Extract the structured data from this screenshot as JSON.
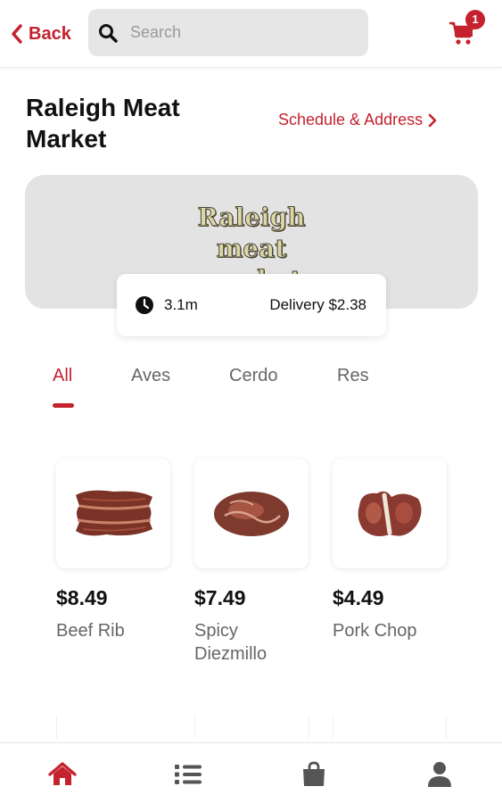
{
  "header": {
    "back_label": "Back",
    "search_placeholder": "Search",
    "cart_count": "1"
  },
  "store": {
    "name": "Raleigh Meat Market",
    "schedule_link": "Schedule & Address",
    "banner_text": "Raleigh meat market",
    "time": "3.1m",
    "delivery": "Delivery $2.38"
  },
  "tabs": [
    {
      "label": "All",
      "active": true
    },
    {
      "label": "Aves",
      "active": false
    },
    {
      "label": "Cerdo",
      "active": false
    },
    {
      "label": "Res",
      "active": false
    }
  ],
  "products": [
    {
      "price": "$8.49",
      "name": "Beef Rib"
    },
    {
      "price": "$7.49",
      "name": "Spicy Diezmillo"
    },
    {
      "price": "$4.49",
      "name": "Pork Chop"
    }
  ],
  "bottom_nav": [
    "home-icon",
    "list-icon",
    "bag-icon",
    "user-icon"
  ],
  "colors": {
    "accent": "#c4222e",
    "banner_bg": "#e3e3e3"
  }
}
